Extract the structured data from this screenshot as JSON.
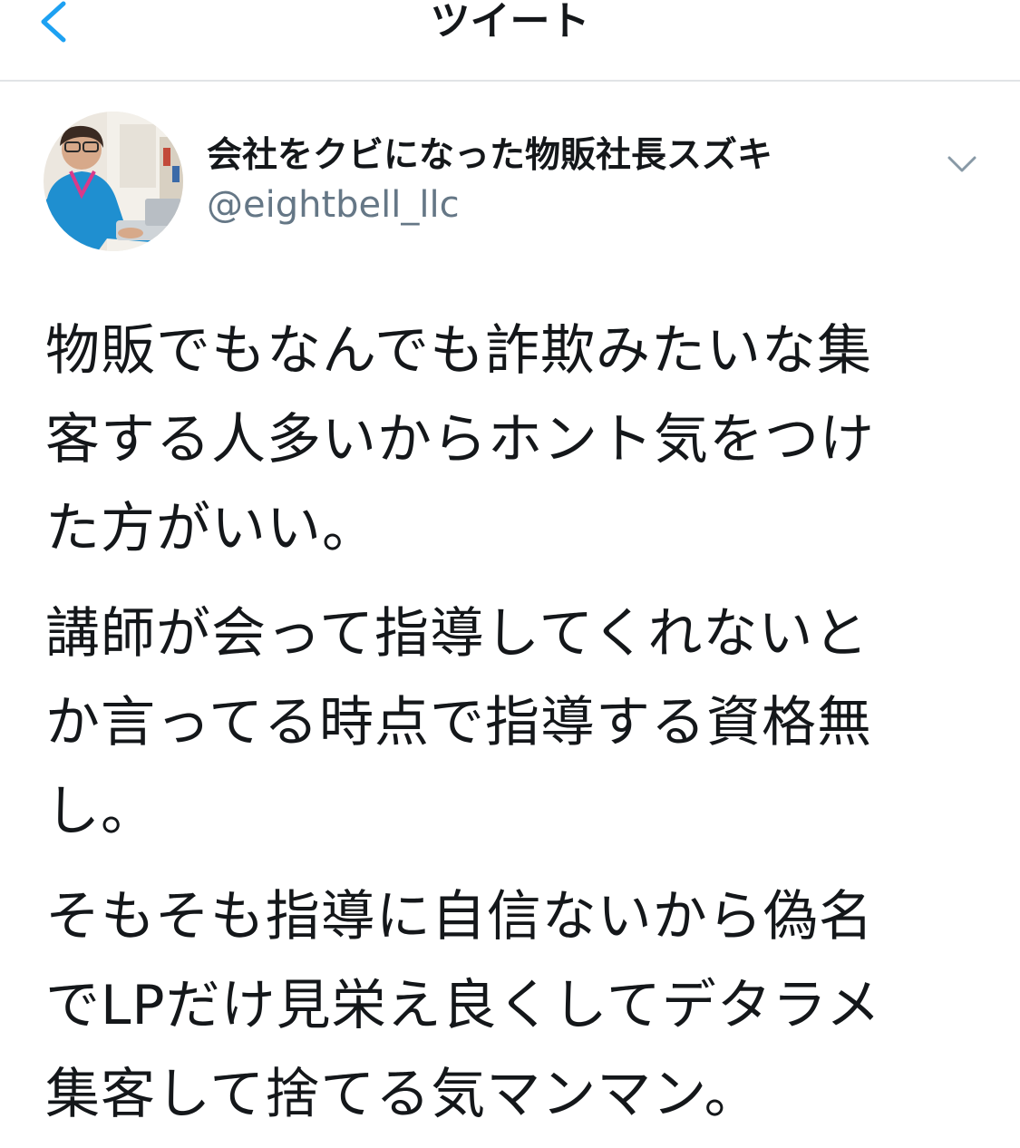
{
  "nav": {
    "title": "ツイート",
    "back_icon": "chevron-left-icon"
  },
  "author": {
    "display_name": "会社をクビになった物販社長スズキ",
    "handle": "@eightbell_llc",
    "menu_icon": "chevron-down-icon"
  },
  "tweet": {
    "paragraphs": [
      [
        "物販でもなんでも詐欺みたいな集",
        "客する人多いからホント気をつけ",
        "た方がいい。"
      ],
      [
        "講師が会って指導してくれないと",
        "か言ってる時点で指導する資格無",
        "し。"
      ],
      [
        "そもそも指導に自信ないから偽名",
        "でLPだけ見栄え良くしてデタラメ",
        "集客して捨てる気マンマン。"
      ]
    ]
  },
  "colors": {
    "accent": "#1da1f2",
    "text": "#14171a",
    "secondary_text": "#657786",
    "divider": "#e1e4e6"
  }
}
